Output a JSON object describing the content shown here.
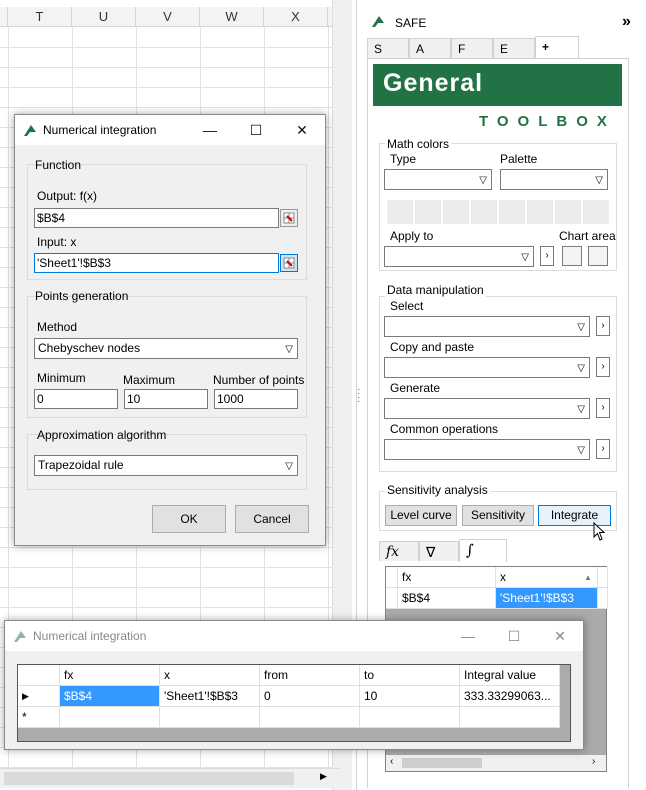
{
  "sheet": {
    "columns": [
      "T",
      "U",
      "V",
      "W",
      "X"
    ]
  },
  "dialog": {
    "title": "Numerical integration",
    "function_group": "Function",
    "output_label": "Output: f(x)",
    "output_value": "$B$4",
    "input_label": "Input: x",
    "input_value": "'Sheet1'!$B$3",
    "points_group": "Points generation",
    "method_label": "Method",
    "method_value": "Chebyschev nodes",
    "min_label": "Minimum",
    "min_value": "0",
    "max_label": "Maximum",
    "max_value": "10",
    "npoints_label": "Number of points",
    "npoints_value": "1000",
    "algo_group": "Approximation algorithm",
    "algo_value": "Trapezoidal rule",
    "ok": "OK",
    "cancel": "Cancel",
    "minimize": "—",
    "maximize": "☐",
    "close": "✕"
  },
  "pane": {
    "title": "SAFE",
    "collapse": "»",
    "tabs": [
      "S",
      "A",
      "F",
      "E",
      "+"
    ],
    "banner_title": "General",
    "banner_sub": "TOOLBOX",
    "banner_color": "#217346",
    "math_colors": "Math colors",
    "type_label": "Type",
    "palette_label": "Palette",
    "apply_to": "Apply to",
    "chart_area": "Chart area",
    "data_manip": "Data manipulation",
    "select": "Select",
    "copy_paste": "Copy and paste",
    "generate": "Generate",
    "common_ops": "Common operations",
    "sensitivity_group": "Sensitivity analysis",
    "level_curve": "Level curve",
    "sensitivity": "Sensitivity",
    "integrate": "Integrate",
    "bottom_tabs": [
      "fx",
      "∇",
      "∫"
    ],
    "grid_headers": [
      "fx",
      "x"
    ],
    "grid_row": [
      "$B$4",
      "'Sheet1'!$B$3"
    ]
  },
  "result": {
    "title": "Numerical integration",
    "headers": [
      "fx",
      "x",
      "from",
      "to",
      "Integral value"
    ],
    "row": [
      "$B$4",
      "'Sheet1'!$B$3",
      "0",
      "10",
      "333.33299063..."
    ],
    "new_row_marker": "*",
    "current_row_marker": "▶"
  }
}
